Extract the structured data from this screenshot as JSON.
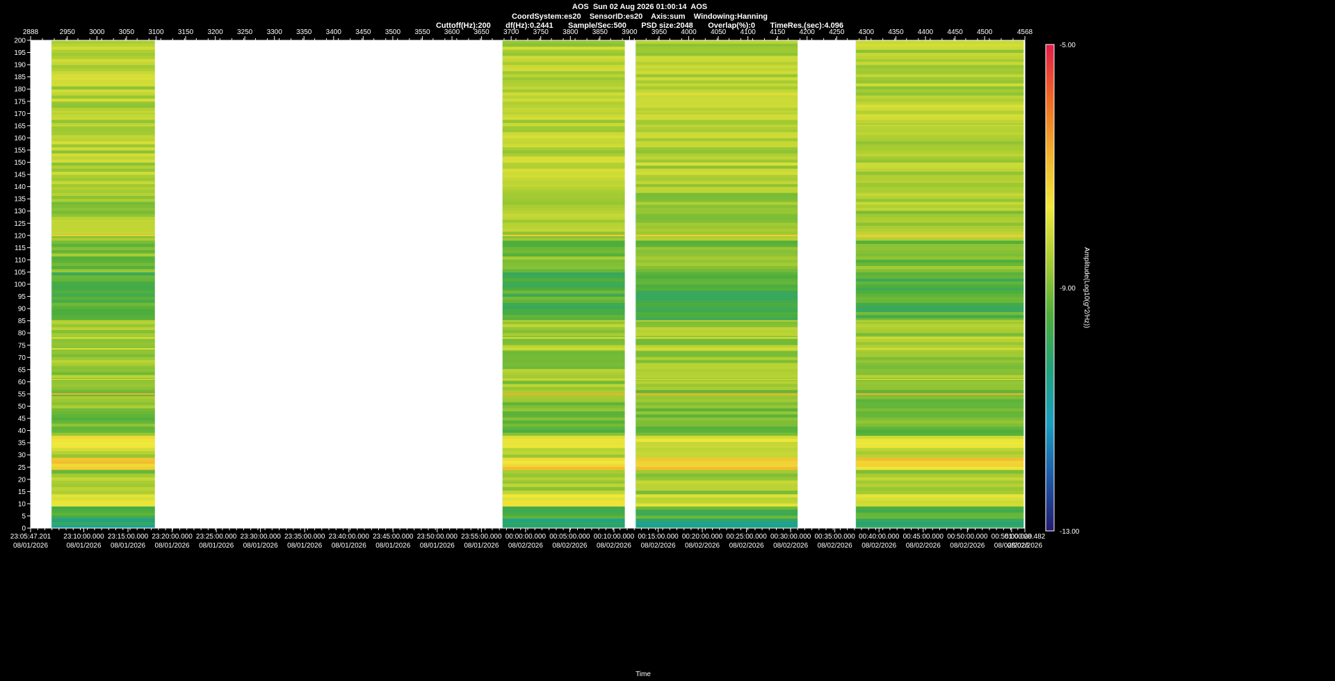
{
  "header": {
    "line1": "AOS  Sun 02 Aug 2026 01:00:14  AOS",
    "line2": "CoordSystem:es20    SensorID:es20    Axis:sum    Windowing:Hanning",
    "line3": "Cuttoff(Hz):200       df(Hz):0.2441       Sample/Sec:500       PSD size:2048       Overlap(%):0       TimeRes.(sec):4.096"
  },
  "chart_data": {
    "type": "heatmap",
    "title": "AOS  Sun 02 Aug 2026 01:00:14  AOS",
    "xlabel": "Time",
    "ylabel": "",
    "ylim": [
      0,
      200
    ],
    "xlim_index": [
      2888,
      4568
    ],
    "top_ticks": [
      "2888",
      "2950",
      "3000",
      "3050",
      "3100",
      "3150",
      "3200",
      "3250",
      "3300",
      "3350",
      "3400",
      "3450",
      "3500",
      "3550",
      "3600",
      "3650",
      "3700",
      "3750",
      "3800",
      "3850",
      "3900",
      "3950",
      "4000",
      "4050",
      "4100",
      "4150",
      "4200",
      "4250",
      "4300",
      "4350",
      "4400",
      "4450",
      "4500",
      "4568"
    ],
    "y_ticks": [
      0,
      5,
      10,
      15,
      20,
      25,
      30,
      35,
      40,
      45,
      50,
      55,
      60,
      65,
      70,
      75,
      80,
      85,
      90,
      95,
      100,
      105,
      110,
      115,
      120,
      125,
      130,
      135,
      140,
      145,
      150,
      155,
      160,
      165,
      170,
      175,
      180,
      185,
      190,
      195,
      200
    ],
    "bottom_ticks": [
      {
        "time": "23:05:47.201",
        "date": "08/01/2026"
      },
      {
        "time": "23:10:00.000",
        "date": "08/01/2026"
      },
      {
        "time": "23:15:00.000",
        "date": "08/01/2026"
      },
      {
        "time": "23:20:00.000",
        "date": "08/01/2026"
      },
      {
        "time": "23:25:00.000",
        "date": "08/01/2026"
      },
      {
        "time": "23:30:00.000",
        "date": "08/01/2026"
      },
      {
        "time": "23:35:00.000",
        "date": "08/01/2026"
      },
      {
        "time": "23:40:00.000",
        "date": "08/01/2026"
      },
      {
        "time": "23:45:00.000",
        "date": "08/01/2026"
      },
      {
        "time": "23:50:00.000",
        "date": "08/01/2026"
      },
      {
        "time": "23:55:00.000",
        "date": "08/01/2026"
      },
      {
        "time": "00:00:00.000",
        "date": "08/02/2026"
      },
      {
        "time": "00:05:00.000",
        "date": "08/02/2026"
      },
      {
        "time": "00:10:00.000",
        "date": "08/02/2026"
      },
      {
        "time": "00:15:00.000",
        "date": "08/02/2026"
      },
      {
        "time": "00:20:00.000",
        "date": "08/02/2026"
      },
      {
        "time": "00:25:00.000",
        "date": "08/02/2026"
      },
      {
        "time": "00:30:00.000",
        "date": "08/02/2026"
      },
      {
        "time": "00:35:00.000",
        "date": "08/02/2026"
      },
      {
        "time": "00:40:00.000",
        "date": "08/02/2026"
      },
      {
        "time": "00:45:00.000",
        "date": "08/02/2026"
      },
      {
        "time": "00:50:00.000",
        "date": "08/02/2026"
      },
      {
        "time": "00:55:00.000",
        "date": "08/02/2026"
      },
      {
        "time": "01:00:28.482",
        "date": "08/02/2026"
      }
    ],
    "data_segments": [
      [
        2923,
        3098
      ],
      [
        3685,
        3892
      ],
      [
        3910,
        4184
      ],
      [
        4282,
        4566
      ]
    ],
    "colorbar": {
      "label": "Amplitude(Log10(g^2/Hz))",
      "max_label": "-5.00",
      "mid_label": "-9.00",
      "min_label": "-13.00",
      "range": [
        -13,
        -5
      ],
      "colors": [
        "#ffffff",
        "#241b6e",
        "#1e5aa8",
        "#1a9fc0",
        "#22a27a",
        "#4fae3b",
        "#a8cc32",
        "#f0e83a",
        "#f2b02c",
        "#ef6a24",
        "#e21c4c"
      ]
    },
    "bands": [
      {
        "lo": 0,
        "hi": 4,
        "level": -10.3
      },
      {
        "lo": 4,
        "hi": 9,
        "level": -9.5
      },
      {
        "lo": 9,
        "hi": 14,
        "level": -8.0
      },
      {
        "lo": 14,
        "hi": 17,
        "level": -8.6
      },
      {
        "lo": 17,
        "hi": 21,
        "level": -8.4
      },
      {
        "lo": 21,
        "hi": 24,
        "level": -8.8
      },
      {
        "lo": 24,
        "hi": 29,
        "level": -7.4
      },
      {
        "lo": 29,
        "hi": 33,
        "level": -8.4
      },
      {
        "lo": 33,
        "hi": 38,
        "level": -7.8
      },
      {
        "lo": 38,
        "hi": 48,
        "level": -9.1
      },
      {
        "lo": 48,
        "hi": 58,
        "level": -8.9
      },
      {
        "lo": 58,
        "hi": 85,
        "level": -8.7
      },
      {
        "lo": 85,
        "hi": 105,
        "level": -9.5
      },
      {
        "lo": 105,
        "hi": 118,
        "level": -9.0
      },
      {
        "lo": 118,
        "hi": 140,
        "level": -8.6
      },
      {
        "lo": 140,
        "hi": 200,
        "level": -8.4
      }
    ],
    "lines": [
      {
        "freq": 120,
        "level": -7.2
      },
      {
        "freq": 78,
        "level": -8.0
      },
      {
        "freq": 73.5,
        "level": -8.0
      },
      {
        "freq": 85,
        "level": -8.4
      },
      {
        "freq": 55,
        "level": -6.8
      },
      {
        "freq": 61,
        "level": -8.2
      },
      {
        "freq": 165,
        "level": -8.2
      },
      {
        "freq": 170,
        "level": -8.4
      },
      {
        "freq": 142,
        "level": -8.3
      }
    ]
  }
}
